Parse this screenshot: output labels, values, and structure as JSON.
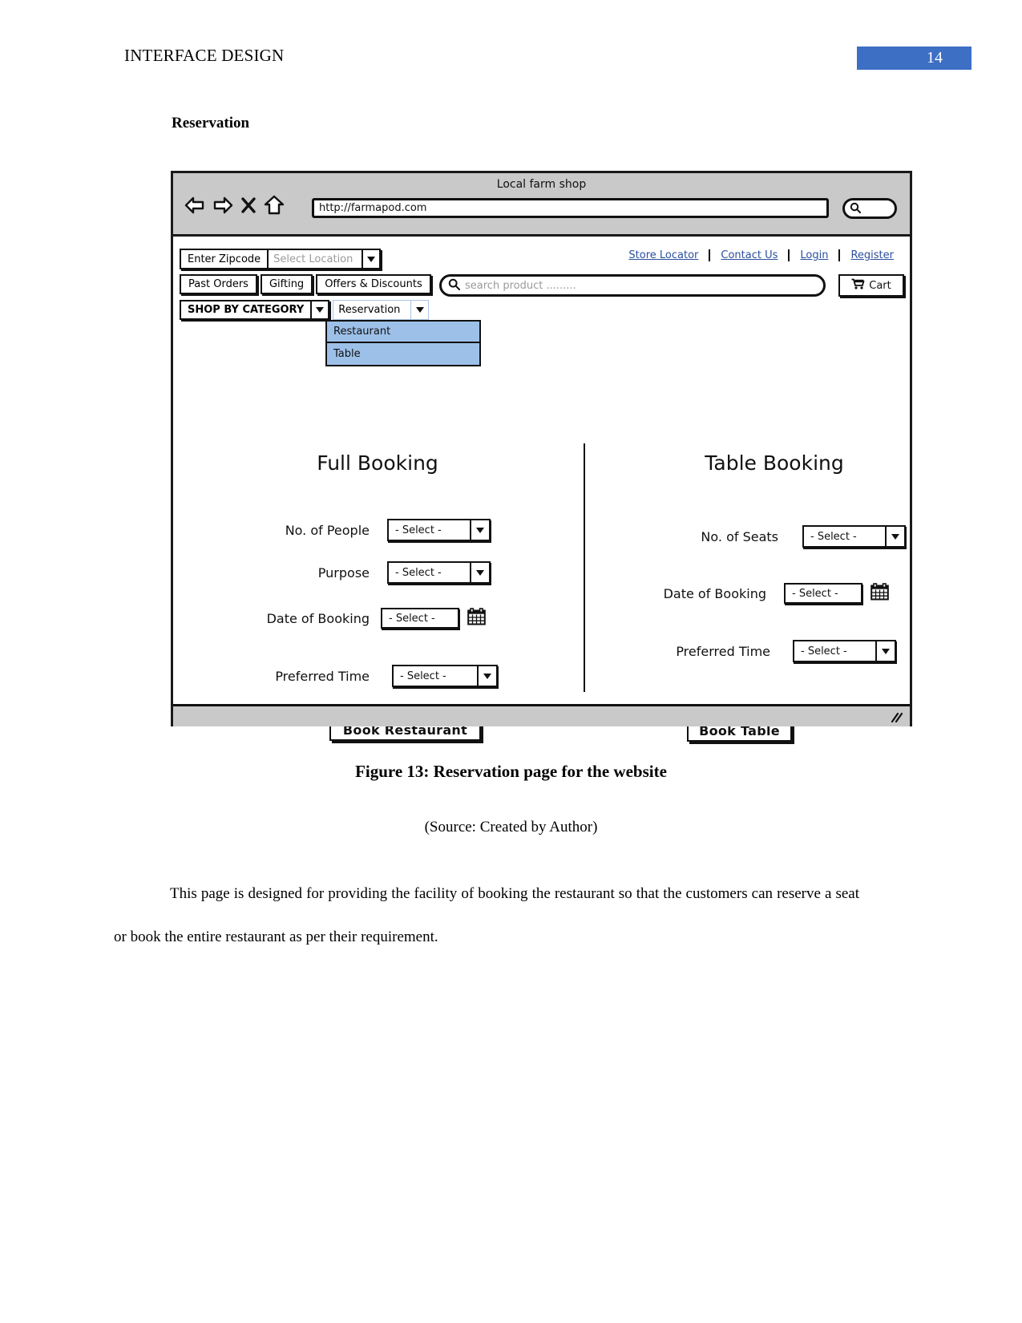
{
  "document": {
    "header_title": "INTERFACE DESIGN",
    "page_number": "14",
    "section_heading": "Reservation",
    "figure_caption": "Figure 13: Reservation page for the website",
    "source_line": "(Source: Created by Author)",
    "body_paragraph": "This page is designed for providing the facility of booking the restaurant so that the customers can reserve a seat or book the entire restaurant as per their requirement.",
    "accent_color": "#3d6fc4"
  },
  "browser": {
    "window_title": "Local farm shop",
    "url": "http://farmapod.com",
    "nav": {
      "back_icon": "back-arrow-icon",
      "forward_icon": "forward-arrow-icon",
      "stop_icon": "close-x-icon",
      "home_icon": "home-icon",
      "search_icon": "search-icon"
    }
  },
  "site": {
    "zipcode_button": "Enter Zipcode",
    "location_select_value": "Select Location",
    "tabs": [
      {
        "label": "Past Orders"
      },
      {
        "label": "Gifting"
      },
      {
        "label": "Offers & Discounts"
      }
    ],
    "category_button": "SHOP BY CATEGORY",
    "reservation_select_value": "Reservation",
    "reservation_options": [
      {
        "label": "Restaurant"
      },
      {
        "label": "Table"
      }
    ],
    "top_links": [
      {
        "label": "Store Locator"
      },
      {
        "label": "Contact Us"
      },
      {
        "label": "Login"
      },
      {
        "label": "Register"
      }
    ],
    "search_placeholder": "search product .........",
    "cart_label": "Cart",
    "dropdown_highlight_color": "#9dc0e8"
  },
  "full_booking": {
    "title": "Full Booking",
    "fields": [
      {
        "label": "No. of People",
        "value": "- Select -",
        "control": "select"
      },
      {
        "label": "Purpose",
        "value": "- Select -",
        "control": "select"
      },
      {
        "label": "Date of Booking",
        "value": "- Select -",
        "control": "date"
      },
      {
        "label": "Preferred Time",
        "value": "- Select -",
        "control": "select"
      }
    ],
    "submit_label": "Book Restaurant"
  },
  "table_booking": {
    "title": "Table Booking",
    "fields": [
      {
        "label": "No. of Seats",
        "value": "- Select -",
        "control": "select"
      },
      {
        "label": "Date of Booking",
        "value": "- Select -",
        "control": "date"
      },
      {
        "label": "Preferred Time",
        "value": "- Select -",
        "control": "select"
      }
    ],
    "submit_label": "Book Table"
  }
}
